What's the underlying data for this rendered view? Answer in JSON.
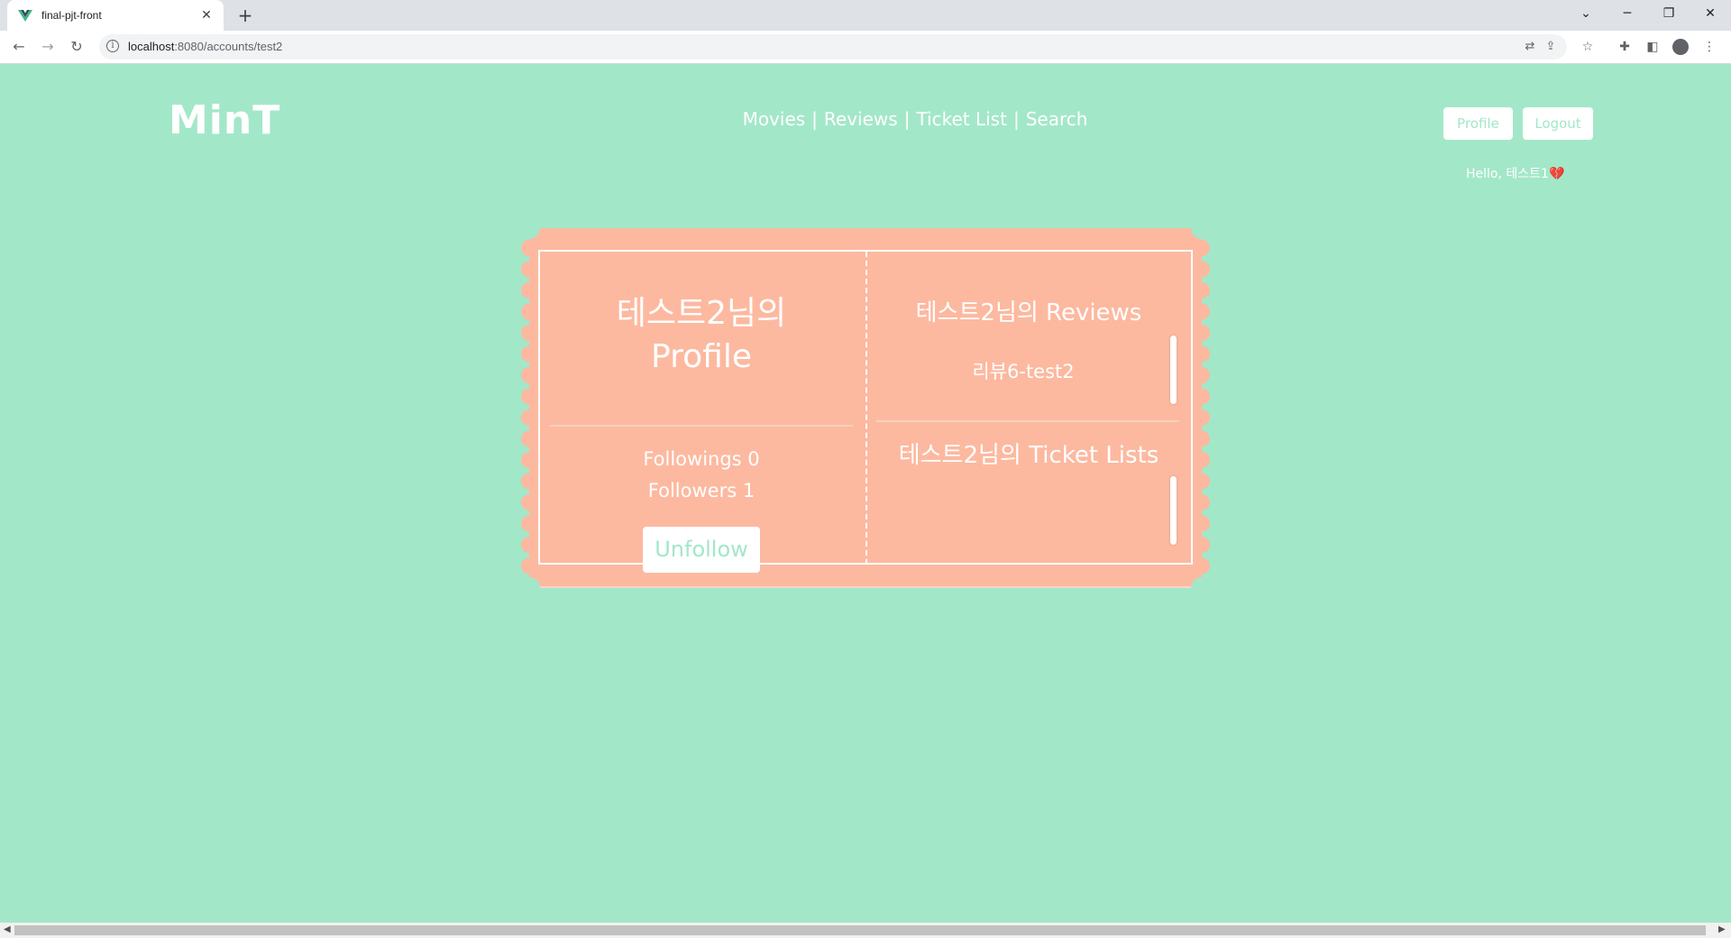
{
  "browser": {
    "tab_title": "final-pjt-front",
    "url_host": "localhost",
    "url_path": ":8080/accounts/test2",
    "new_tab": "+",
    "tab_close": "✕"
  },
  "header": {
    "logo": "MinT",
    "nav": [
      "Movies",
      "Reviews",
      "Ticket List",
      "Search"
    ],
    "nav_separator": "|",
    "profile_button": "Profile",
    "logout_button": "Logout",
    "greeting": "Hello, 테스트1",
    "greeting_emoji": "💔"
  },
  "profile": {
    "title_line1": "테스트2님의",
    "title_line2": "Profile",
    "followings": "Followings 0",
    "followers": "Followers 1",
    "unfollow_button": "Unfollow",
    "reviews_title": "테스트2님의 Reviews",
    "reviews": [
      "리뷰6-test2"
    ],
    "ticket_lists_title": "테스트2님의 Ticket Lists"
  },
  "colors": {
    "background": "#a3e7c9",
    "ticket": "#fcb9a0",
    "accent_text": "#a3e7c9"
  }
}
